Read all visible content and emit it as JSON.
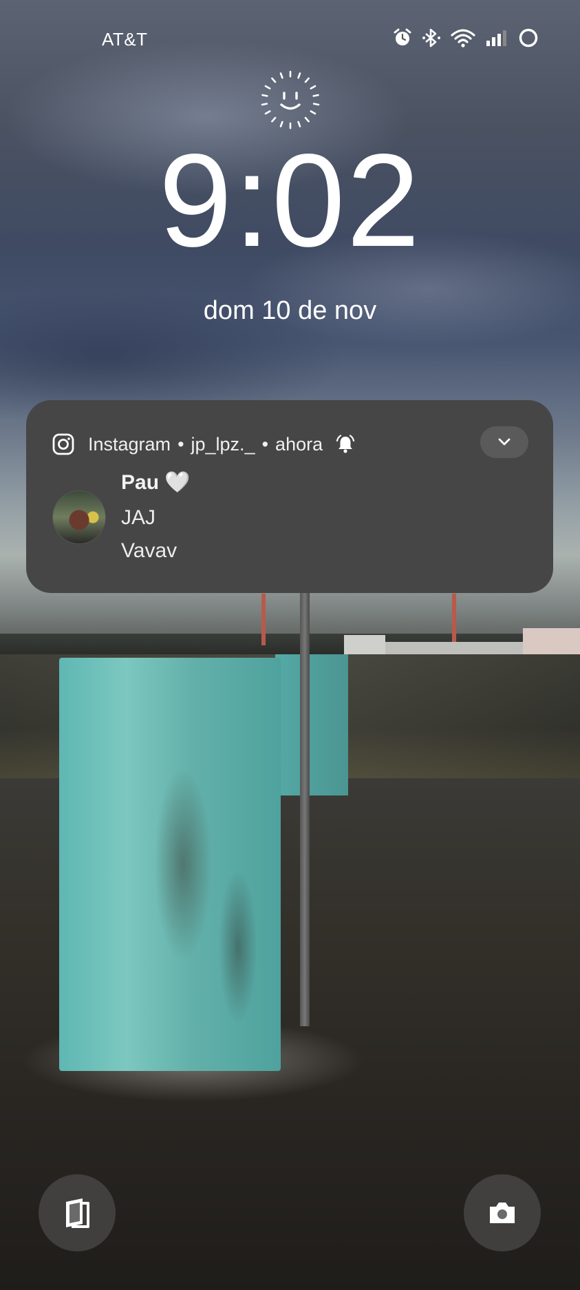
{
  "status_bar": {
    "carrier": "AT&T",
    "icons": [
      "alarm-icon",
      "bluetooth-icon",
      "wifi-icon",
      "signal-icon",
      "battery-icon"
    ]
  },
  "lock_screen": {
    "face_unlock_icon": "face-unlock-icon",
    "time": "9:02",
    "date": "dom 10 de nov"
  },
  "notification": {
    "app_icon": "instagram-icon",
    "app_name": "Instagram",
    "account": "jp_lpz._",
    "time": "ahora",
    "separator": "•",
    "sender": "Pau 🤍",
    "messages": [
      "JAJ",
      "Vavav"
    ]
  },
  "shortcuts": {
    "left": "wallet-icon",
    "right": "camera-icon"
  }
}
